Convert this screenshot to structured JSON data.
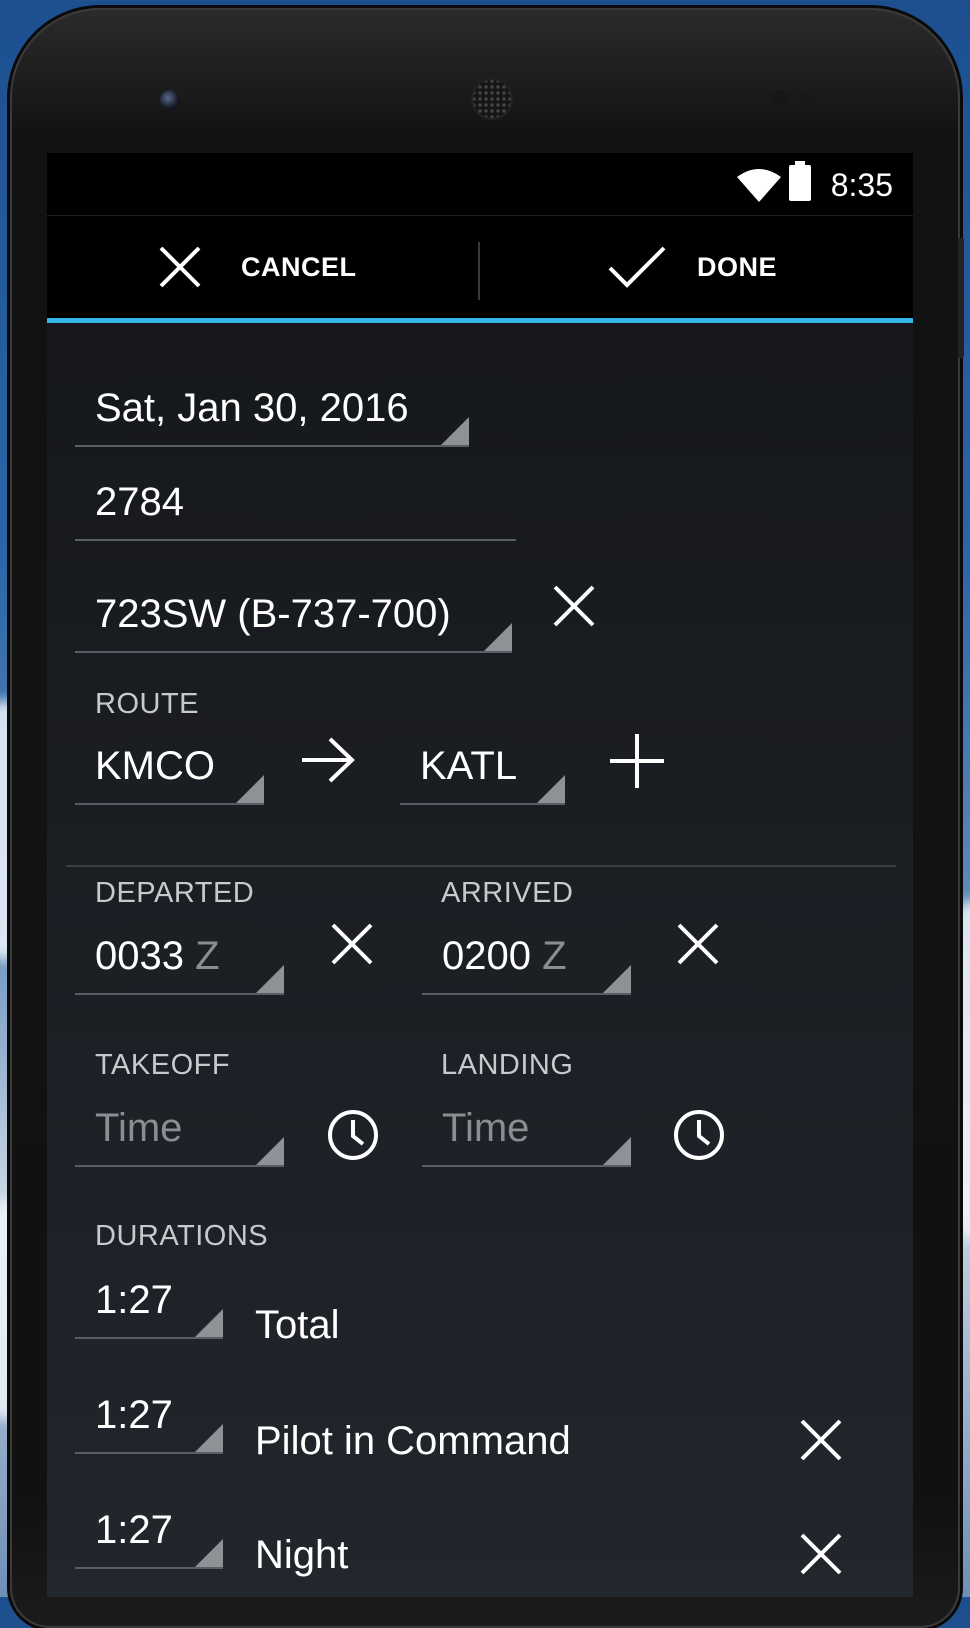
{
  "status": {
    "time": "8:35"
  },
  "actionbar": {
    "cancel_label": "CANCEL",
    "done_label": "DONE"
  },
  "form": {
    "date": "Sat, Jan 30, 2016",
    "flight_number": "2784",
    "aircraft": "723SW (B-737-700)",
    "route": {
      "label": "ROUTE",
      "from": "KMCO",
      "to": "KATL"
    },
    "departed": {
      "label": "DEPARTED",
      "value": "0033",
      "suffix": "Z"
    },
    "arrived": {
      "label": "ARRIVED",
      "value": "0200",
      "suffix": "Z"
    },
    "takeoff": {
      "label": "TAKEOFF",
      "placeholder": "Time"
    },
    "landing": {
      "label": "LANDING",
      "placeholder": "Time"
    },
    "durations": {
      "label": "DURATIONS",
      "items": [
        {
          "value": "1:27",
          "name": "Total"
        },
        {
          "value": "1:27",
          "name": "Pilot in Command"
        },
        {
          "value": "1:27",
          "name": "Night"
        }
      ]
    }
  },
  "colors": {
    "accent": "#33b5e5",
    "background": "#1b1e23"
  },
  "icons": [
    "close-icon",
    "checkmark-icon",
    "arrow-right-icon",
    "plus-icon",
    "clock-icon",
    "wifi-icon",
    "battery-icon"
  ]
}
